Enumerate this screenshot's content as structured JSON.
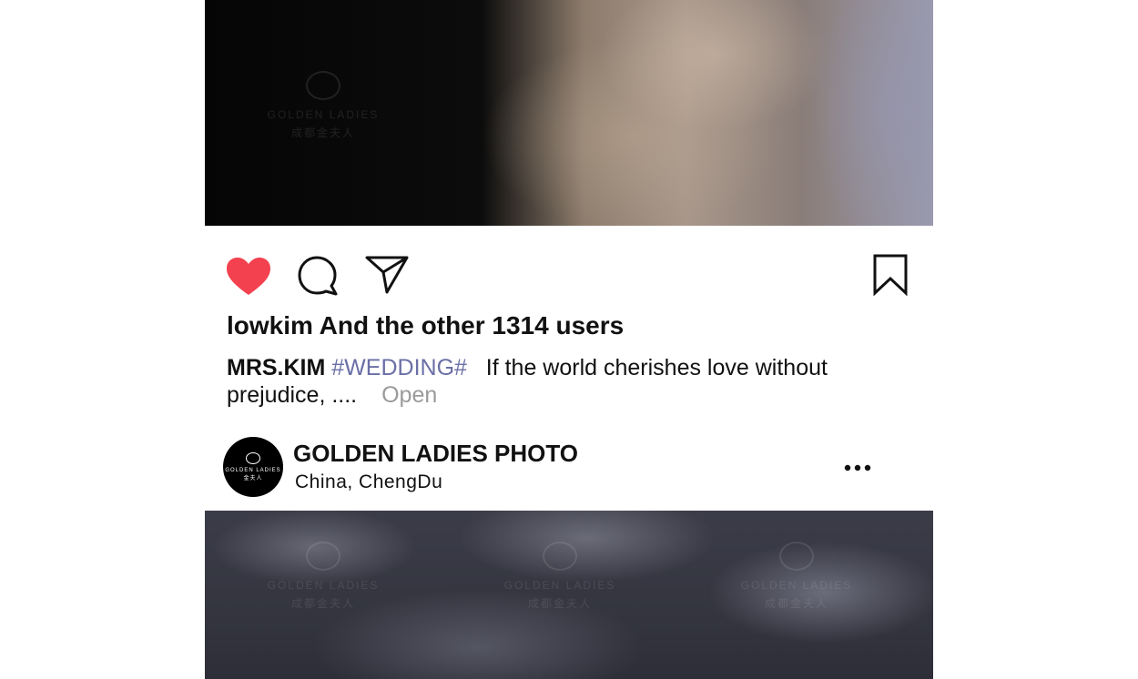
{
  "post": {
    "likes_text": "lowkim And the other 1314 users",
    "caption": {
      "author": "MRS.KIM",
      "hashtag": "#WEDDING#",
      "text": "If the world cherishes love without prejudice, ....",
      "open_label": "Open"
    },
    "icons": {
      "like": "heart-icon",
      "comment": "comment-bubble-icon",
      "share": "send-icon",
      "save": "bookmark-icon",
      "more": "more-dots-icon"
    },
    "colors": {
      "like_active": "#f3414f",
      "hashtag": "#6a6fa6",
      "open_link": "#9a9a9a"
    }
  },
  "next_post": {
    "account_name": "GOLDEN LADIES PHOTO",
    "location": "China,  ChengDu",
    "avatar_text": "GOLDEN LADIES",
    "avatar_subtext": "金夫人"
  },
  "watermark": {
    "brand": "GOLDEN LADIES",
    "subtitle": "成都金夫人"
  }
}
